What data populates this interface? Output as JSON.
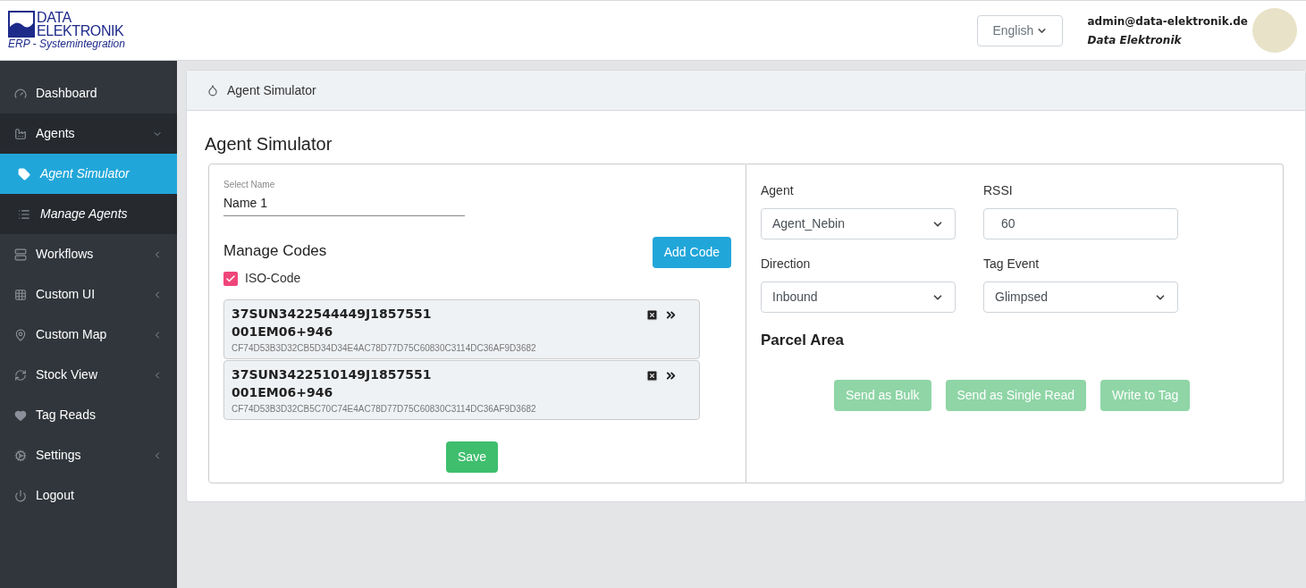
{
  "header": {
    "logo": {
      "line_1": "DATA",
      "line_2": "ELEKTRONIK",
      "tagline": "ERP - Systemintegration"
    },
    "language": "English",
    "user_email": "admin@data-elektronik.de",
    "company": "Data Elektronik"
  },
  "sidebar": {
    "items": [
      {
        "label": "Dashboard",
        "kind": "gauge",
        "selected": false
      },
      {
        "label": "Agents",
        "kind": "factory",
        "selected": false,
        "expanded": true,
        "children": [
          {
            "label": "Agent Simulator",
            "kind": "tag",
            "selected": true
          },
          {
            "label": "Manage Agents",
            "kind": "list",
            "selected": false
          }
        ]
      },
      {
        "label": "Workflows",
        "kind": "server",
        "selected": false,
        "expanded": false
      },
      {
        "label": "Custom UI",
        "kind": "grid",
        "selected": false,
        "expanded": false
      },
      {
        "label": "Custom Map",
        "kind": "pin",
        "selected": false,
        "expanded": false
      },
      {
        "label": "Stock View",
        "kind": "sync",
        "selected": false,
        "expanded": false
      },
      {
        "label": "Tag Reads",
        "kind": "heart",
        "selected": false
      },
      {
        "label": "Settings",
        "kind": "cogs",
        "selected": false,
        "expanded": false
      },
      {
        "label": "Logout",
        "kind": "power",
        "selected": false
      }
    ]
  },
  "breadcrumb": "Agent Simulator",
  "page_title": "Agent Simulator",
  "left_panel": {
    "name_field": {
      "label": "Select Name",
      "value": "Name 1"
    },
    "section_title": "Manage Codes",
    "add_button": "Add Code",
    "iso_checkbox": {
      "label": "ISO-Code",
      "checked": true
    },
    "codes": [
      {
        "code": "37SUN3422544449J1857551",
        "sub_code": "001EM06+946",
        "hex": "CF74D53B3D32CB5D34D34E4AC78D77D75C60830C3114DC36AF9D3682"
      },
      {
        "code": "37SUN3422510149J1857551",
        "sub_code": "001EM06+946",
        "hex": "CF74D53B3D32CB5C70C74E4AC78D77D75C60830C3114DC36AF9D3682"
      }
    ],
    "save_button": "Save"
  },
  "right_panel": {
    "fields": [
      {
        "label": "Agent",
        "kind": "select",
        "value": "Agent_Nebin"
      },
      {
        "label": "RSSI",
        "kind": "input",
        "value": "60"
      },
      {
        "label": "Direction",
        "kind": "select",
        "value": "Inbound"
      },
      {
        "label": "Tag Event",
        "kind": "select",
        "value": "Glimpsed"
      }
    ],
    "section_title": "Parcel Area",
    "buttons": [
      {
        "label": "Send as Bulk",
        "disabled": true
      },
      {
        "label": "Send as Single Read",
        "disabled": true
      },
      {
        "label": "Write to Tag",
        "disabled": true
      }
    ]
  }
}
